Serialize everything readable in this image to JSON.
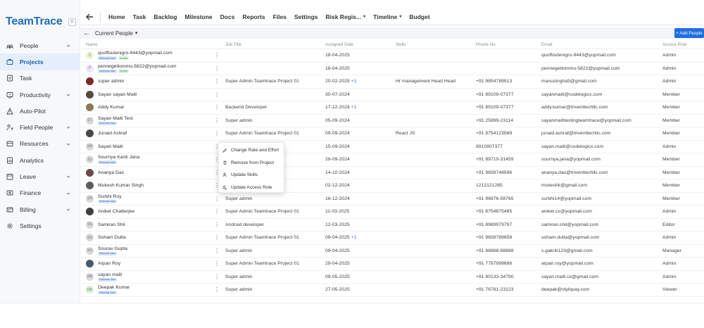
{
  "app": {
    "brand": "TeamTrace",
    "brand_badge": "≡",
    "accent": "#1f6fe0"
  },
  "sidebar": {
    "items": [
      {
        "label": "People",
        "icon": "people-icon",
        "chevron": true,
        "active": false
      },
      {
        "label": "Projects",
        "icon": "projects-icon",
        "chevron": false,
        "active": true
      },
      {
        "label": "Task",
        "icon": "task-icon",
        "chevron": false,
        "active": false
      },
      {
        "label": "Productivity",
        "icon": "productivity-icon",
        "chevron": true,
        "active": false
      },
      {
        "label": "Auto-Pilot",
        "icon": "autopilot-icon",
        "chevron": false,
        "active": false
      },
      {
        "label": "Field People",
        "icon": "field-people-icon",
        "chevron": true,
        "active": false
      },
      {
        "label": "Resources",
        "icon": "resources-icon",
        "chevron": true,
        "active": false
      },
      {
        "label": "Analytics",
        "icon": "analytics-icon",
        "chevron": false,
        "active": false
      },
      {
        "label": "Leave",
        "icon": "leave-icon",
        "chevron": true,
        "active": false
      },
      {
        "label": "Finance",
        "icon": "finance-icon",
        "chevron": true,
        "active": false
      },
      {
        "label": "Billing",
        "icon": "billing-icon",
        "chevron": true,
        "active": false
      },
      {
        "label": "Settings",
        "icon": "settings-icon",
        "chevron": false,
        "active": false
      }
    ]
  },
  "topnav": {
    "tabs": [
      {
        "label": "Home",
        "dropdown": false
      },
      {
        "label": "Task",
        "dropdown": false
      },
      {
        "label": "Backlog",
        "dropdown": false
      },
      {
        "label": "Milestone",
        "dropdown": false
      },
      {
        "label": "Docs",
        "dropdown": false
      },
      {
        "label": "Reports",
        "dropdown": false
      },
      {
        "label": "Files",
        "dropdown": false
      },
      {
        "label": "Settings",
        "dropdown": false
      },
      {
        "label": "Risk Regis...",
        "dropdown": true
      },
      {
        "label": "Timeline",
        "dropdown": true
      },
      {
        "label": "Budget",
        "dropdown": false
      }
    ]
  },
  "subheader": {
    "title": "Current People",
    "add_button": "+ Add People"
  },
  "table": {
    "columns": [
      "Name",
      "Job Title",
      "Assigned Date",
      "Skills",
      "Phone No.",
      "Email",
      "Access Role"
    ],
    "rows": [
      {
        "name": "quoffoutenigro-9443@yopmail.com",
        "avatar": "Q",
        "avatar_color": "#e9f3d8",
        "avatar_text_color": "#7aa34a",
        "badges": [
          "External User",
          "Invited"
        ],
        "job": "",
        "date": "18-04-2025",
        "plus": "",
        "skills": "",
        "phone": "",
        "email": "quoffoutenigro-9443@yopmail.com",
        "role": "Admin"
      },
      {
        "name": "pennegettommu-5822@yopmail.com",
        "avatar": "P",
        "avatar_color": "#efe3f7",
        "avatar_text_color": "#9b63c4",
        "badges": [
          "External User",
          "Invited"
        ],
        "job": "",
        "date": "18-04-2025",
        "plus": "",
        "skills": "",
        "phone": "",
        "email": "pennegettommu-5822@yopmail.com",
        "role": "Admin"
      },
      {
        "name": "super admin",
        "avatar": "",
        "avatar_color": "#7a2a2a",
        "avatar_text_color": "#fff",
        "badges": [],
        "job": "Super Admin Teamtrace Project 01",
        "date": "20-02-2025",
        "plus": "+1",
        "skills": "Hr management Head Head",
        "phone": "+91 9854789513",
        "email": "manusingha5@gmail.com",
        "role": "Admin"
      },
      {
        "name": "Sayan sayan Maiti",
        "avatar": "",
        "avatar_color": "#5a4a3e",
        "avatar_text_color": "#fff",
        "badges": [],
        "job": "",
        "date": "30-07-2024",
        "plus": "",
        "skills": "",
        "phone": "+91 89109-07377",
        "email": "sayanmaiti@codelogicx.com",
        "role": "Member"
      },
      {
        "name": "Addy Kumar",
        "avatar": "",
        "avatar_color": "#8a7a55",
        "avatar_text_color": "#fff",
        "badges": [],
        "job": "Backend Developer",
        "date": "17-12-2024",
        "plus": "+1",
        "skills": "",
        "phone": "+91 89109-07377",
        "email": "addy.kumar@triventtechllc.com",
        "role": "Member"
      },
      {
        "name": "Sayan Maiti Test",
        "avatar": "ST",
        "avatar_color": "#d8dadd",
        "avatar_text_color": "#777",
        "badges": [
          "External User"
        ],
        "job": "Super admin",
        "date": "05-09-2024",
        "plus": "",
        "skills": "",
        "phone": "+91 25899-23114",
        "email": "sayanmaititestingteamtrace@yopmail.com",
        "role": "Member"
      },
      {
        "name": "Junaid Ashraf",
        "avatar": "",
        "avatar_color": "#4a4a4a",
        "avatar_text_color": "#fff",
        "badges": [],
        "job": "Super Admin Teamtrace Project 01",
        "date": "09-09-2024",
        "plus": "",
        "skills": "React JS",
        "phone": "+91 8754123589",
        "email": "junaid.ashraf@triventtechllc.com",
        "role": "Member"
      },
      {
        "name": "Sayan Maiti",
        "avatar": "SM",
        "avatar_color": "#d8dadd",
        "avatar_text_color": "#777",
        "badges": [],
        "job": "",
        "date": "15-09-2024",
        "plus": "",
        "skills": "",
        "phone": "8910907377",
        "email": "sayan.maiti@codelogicx.com",
        "role": "Admin"
      },
      {
        "name": "Sournya Kanti Jana",
        "avatar": "SJ",
        "avatar_color": "#d8dadd",
        "avatar_text_color": "#777",
        "badges": [
          "External User"
        ],
        "job": "",
        "date": "29-09-2024",
        "plus": "",
        "skills": "",
        "phone": "+91 89710-31459",
        "email": "sournya.jana@yopmail.com",
        "role": "Member"
      },
      {
        "name": "Ananya Das",
        "avatar": "",
        "avatar_color": "#6b4a4a",
        "avatar_text_color": "#fff",
        "badges": [],
        "job": "",
        "date": "14-10-2024",
        "plus": "",
        "skills": "",
        "phone": "+91 9658748596",
        "email": "ananya.das@triventtechllc.com",
        "role": "Member"
      },
      {
        "name": "Mukesh Kumar Singh",
        "avatar": "",
        "avatar_color": "#5e5e5e",
        "avatar_text_color": "#fff",
        "badges": [],
        "job": "",
        "date": "02-12-2024",
        "plus": "",
        "skills": "",
        "phone": "1212121285",
        "email": "mukeshk@gmail.com",
        "role": "Member"
      },
      {
        "name": "Surbhi Roy",
        "avatar": "SR",
        "avatar_color": "#d8dadd",
        "avatar_text_color": "#777",
        "badges": [
          "External User"
        ],
        "job": "Super admin",
        "date": "16-12-2024",
        "plus": "",
        "skills": "",
        "phone": "+91 98876-58765",
        "email": "surbhi14@yopmail.com",
        "role": "Member"
      },
      {
        "name": "Aniket Chatterjee",
        "avatar": "",
        "avatar_color": "#3e3e3e",
        "avatar_text_color": "#fff",
        "badges": [],
        "job": "Super Admin Teamtrace Project 01",
        "date": "11-03-2025",
        "plus": "",
        "skills": "",
        "phone": "+91 8754875485",
        "email": "aniket.cx@yopmail.com",
        "role": "Admin"
      },
      {
        "name": "Samiran Shil",
        "avatar": "SS",
        "avatar_color": "#d8dadd",
        "avatar_text_color": "#777",
        "badges": [],
        "job": "Android developer",
        "date": "12-03-2025",
        "plus": "",
        "skills": "",
        "phone": "+91 8989979797",
        "email": "samiran.shil@yopmail.com",
        "role": "Editor"
      },
      {
        "name": "Soham Dutta",
        "avatar": "SD",
        "avatar_color": "#d8dadd",
        "avatar_text_color": "#777",
        "badges": [],
        "job": "Super Admin Teamtrace Project 01",
        "date": "09-04-2025",
        "plus": "+1",
        "skills": "",
        "phone": "+91 9658789658",
        "email": "soham.dutta@yopmail.com",
        "role": "Admin"
      },
      {
        "name": "Sourav Gupta",
        "avatar": "SG",
        "avatar_color": "#d8dadd",
        "avatar_text_color": "#777",
        "badges": [
          "External User"
        ],
        "job": "Super admin",
        "date": "09-04-2025",
        "plus": "",
        "skills": "",
        "phone": "+91 88888-88888",
        "email": "s.gakriti123@gmail.com",
        "role": "Manager"
      },
      {
        "name": "Arpan Roy",
        "avatar": "",
        "avatar_color": "#4a5a6a",
        "avatar_text_color": "#fff",
        "badges": [],
        "job": "Super Admin Teamtrace Project 01",
        "date": "29-04-2025",
        "plus": "",
        "skills": "",
        "phone": "+91 7787999686",
        "email": "arpan.roy@yopmail.com",
        "role": "Admin"
      },
      {
        "name": "sayan maiti",
        "avatar": "SM",
        "avatar_color": "#d8dadd",
        "avatar_text_color": "#777",
        "badges": [
          "External User"
        ],
        "job": "Super admin",
        "date": "09-05-2025",
        "plus": "",
        "skills": "",
        "phone": "+91 80133-34790",
        "email": "sayan.maiti.cx@gmail.com",
        "role": "Admin"
      },
      {
        "name": "Deepak Kumar",
        "avatar": "DK",
        "avatar_color": "#d5efd9",
        "avatar_text_color": "#3c9a56",
        "badges": [
          "External User"
        ],
        "job": "Super admin",
        "date": "27-05-2025",
        "plus": "",
        "skills": "",
        "phone": "+91 76781-23123",
        "email": "deepak@stylopay.com",
        "role": "Viewer"
      }
    ]
  },
  "context_menu": {
    "items": [
      {
        "label": "Change Rate and Effort",
        "icon": "pencil-icon"
      },
      {
        "label": "Remove from Project",
        "icon": "trash-icon"
      },
      {
        "label": "Update Skills",
        "icon": "user-icon"
      },
      {
        "label": "Update Access Role",
        "icon": "user-search-icon"
      }
    ]
  }
}
